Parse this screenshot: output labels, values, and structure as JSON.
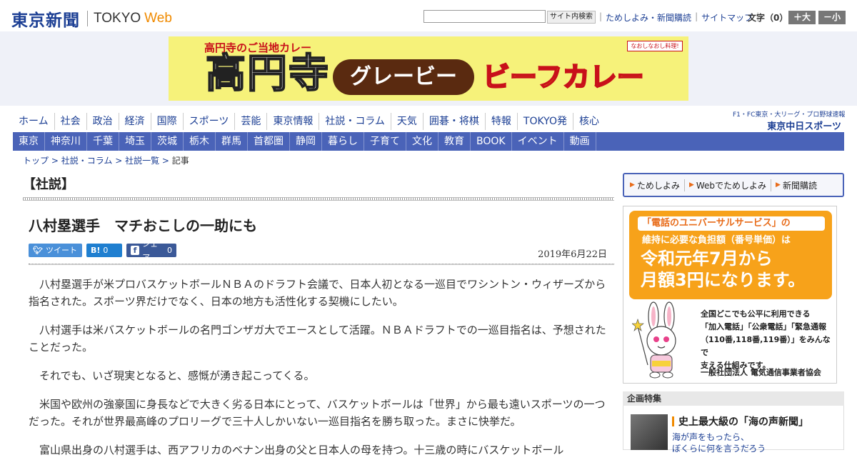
{
  "header": {
    "logo_jp": "東京新聞",
    "logo_en": "TOKYO",
    "logo_web": "Web",
    "search_button": "サイト内検索",
    "links": [
      "ためしよみ・新聞購読",
      "サイトマップ"
    ],
    "font_size_label": "文字（0）",
    "font_plus": "＋大",
    "font_minus": "－小"
  },
  "banner": {
    "top_line": "高円寺のご当地カレー",
    "koenji": "高円寺",
    "gravy": "グレービー",
    "beef": "ビーフカレー",
    "badge": "なおしなおし料理!"
  },
  "nav_main": [
    "ホーム",
    "社会",
    "政治",
    "経済",
    "国際",
    "スポーツ",
    "芸能",
    "東京情報",
    "社説・コラム",
    "天気",
    "囲碁・将棋",
    "特報",
    "TOKYO発",
    "核心"
  ],
  "chunichi": {
    "small": "F1・FC東京・大リーグ・プロ野球速報",
    "big": "東京中日スポーツ"
  },
  "nav_region": [
    "東京",
    "神奈川",
    "千葉",
    "埼玉",
    "茨城",
    "栃木",
    "群馬",
    "首都圏",
    "静岡",
    "暮らし",
    "子育て",
    "文化",
    "教育",
    "BOOK",
    "イベント",
    "動画"
  ],
  "breadcrumb": [
    "トップ",
    "社説・コラム",
    "社説一覧",
    "記事"
  ],
  "article": {
    "section": "【社説】",
    "title": "八村塁選手　マチおこしの一助にも",
    "date": "2019年6月22日",
    "social": {
      "tweet": "ツイート",
      "hatena_count": "0",
      "share": "シェア",
      "share_count": "0"
    },
    "paragraphs": [
      "八村塁選手が米プロバスケットボールＮＢＡのドラフト会議で、日本人初となる一巡目でワシントン・ウィザーズから指名された。スポーツ界だけでなく、日本の地方も活性化する契機にしたい。",
      "八村選手は米バスケットボールの名門ゴンザガ大でエースとして活躍。ＮＢＡドラフトでの一巡目指名は、予想されたことだった。",
      "それでも、いざ現実となると、感慨が湧き起こってくる。",
      "米国や欧州の強豪国に身長などで大きく劣る日本にとって、バスケットボールは「世界」から最も遠いスポーツの一つだった。それが世界最高峰のプロリーグで三十人しかいない一巡目指名を勝ち取った。まさに快挙だ。",
      "富山県出身の八村選手は、西アフリカのベナン出身の父と日本人の母を持つ。十三歳の時にバスケットボール"
    ]
  },
  "promo": [
    "ためしよみ",
    "Webでためしよみ",
    "新聞購読"
  ],
  "ad_universal": {
    "line1": "「電話のユニバーサルサービス」の",
    "line2": "維持に必要な負担額（番号単価）は",
    "line3": "令和元年7月から",
    "line4": "月額3円になります。",
    "text1": "全国どこでも公平に利用できる",
    "text2": "「加入電話」「公衆電話」「緊急通報",
    "text3": "（110番,118番,119番）」をみんなで",
    "text4": "支える仕組みです。",
    "org": "一般社団法人 電気通信事業者協会"
  },
  "kikaku": {
    "header": "企画特集",
    "title": "史上最大級の「海の声新聞」",
    "sub1": "海が声をもったら、",
    "sub2": "ぼくらに何を言うだろう"
  },
  "colors": {
    "brand_blue": "#1c3f94",
    "nav_blue": "#4a63b8",
    "accent_orange": "#f08a00"
  }
}
